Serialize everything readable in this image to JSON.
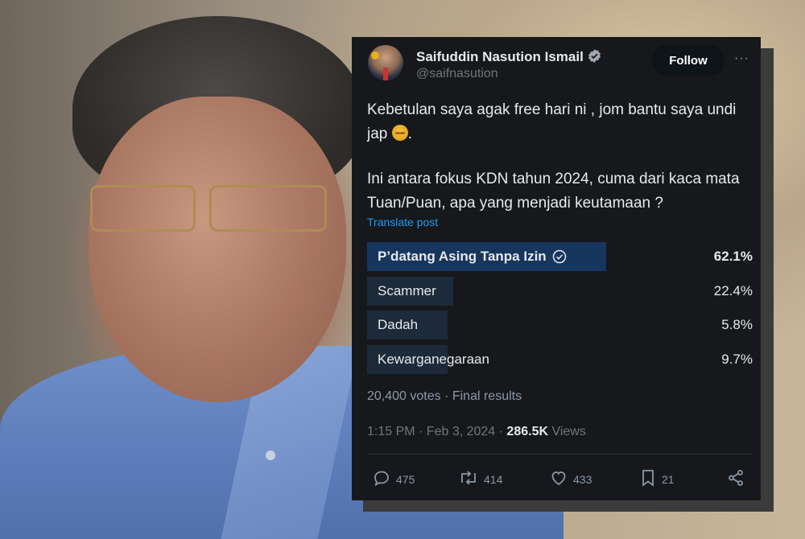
{
  "tweet": {
    "author_name": "Saifuddin Nasution Ismail",
    "handle": "@saifnasution",
    "follow_label": "Follow",
    "more_label": "···",
    "text_line1": "Kebetulan saya agak free hari ni , jom bantu saya undi jap",
    "text_line1_end": ".",
    "text_line2": "Ini antara fokus KDN tahun 2024, cuma dari kaca mata Tuan/Puan, apa yang menjadi keutamaan ?",
    "translate_label": "Translate post"
  },
  "poll": {
    "options": [
      {
        "label": "P’datang Asing Tanpa Izin",
        "percent": 62.1,
        "percent_label": "62.1%",
        "winner": true
      },
      {
        "label": "Scammer",
        "percent": 22.4,
        "percent_label": "22.4%",
        "winner": false
      },
      {
        "label": "Dadah",
        "percent": 5.8,
        "percent_label": "5.8%",
        "winner": false
      },
      {
        "label": "Kewarganegaraan",
        "percent": 9.7,
        "percent_label": "9.7%",
        "winner": false
      }
    ],
    "summary": "20,400 votes · Final results"
  },
  "meta": {
    "time": "1:15 PM · Feb 3, 2024 · ",
    "views_count": "286.5K",
    "views_label": " Views"
  },
  "actions": {
    "replies": "475",
    "reposts": "414",
    "likes": "433",
    "bookmarks": "21"
  },
  "colors": {
    "card_bg": "#16181c",
    "accent": "#1d9bf0",
    "winner_bar": "#16365e",
    "bar": "#1d2a3a"
  }
}
